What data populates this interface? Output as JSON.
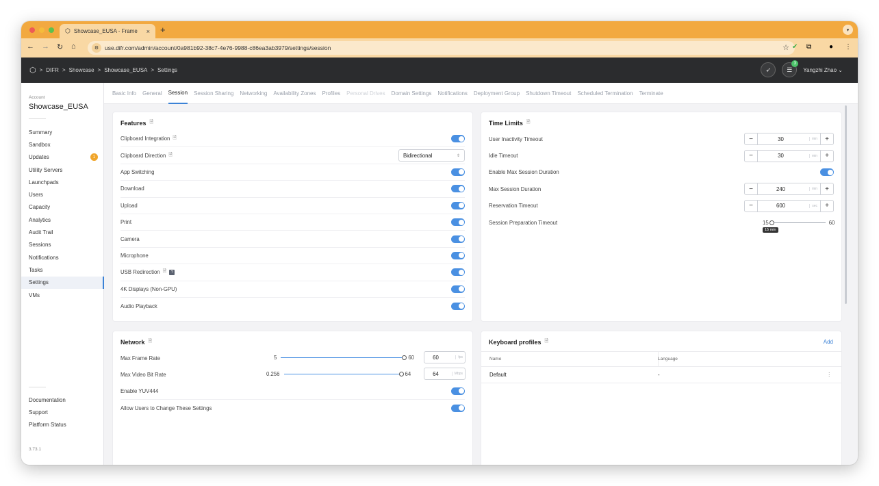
{
  "browser": {
    "tab_title": "Showcase_EUSA - Frame",
    "tab_close": "×",
    "new_tab": "+",
    "url": "use.difr.com/admin/account/0a981b92-38c7-4e76-9988-c86ea3ab3979/settings/session"
  },
  "header": {
    "breadcrumb": [
      "DIFR",
      "Showcase",
      "Showcase_EUSA",
      "Settings"
    ],
    "separator": ">",
    "notification_count": "3",
    "user_name": "Yangzhi Zhao"
  },
  "sidebar": {
    "account_label": "Account",
    "account_name": "Showcase_EUSA",
    "items": [
      {
        "label": "Summary"
      },
      {
        "label": "Sandbox"
      },
      {
        "label": "Updates",
        "badge": "1"
      },
      {
        "label": "Utility Servers"
      },
      {
        "label": "Launchpads"
      },
      {
        "label": "Users"
      },
      {
        "label": "Capacity"
      },
      {
        "label": "Analytics"
      },
      {
        "label": "Audit Trail"
      },
      {
        "label": "Sessions"
      },
      {
        "label": "Notifications"
      },
      {
        "label": "Tasks"
      },
      {
        "label": "Settings",
        "active": true
      },
      {
        "label": "VMs"
      }
    ],
    "footer_items": [
      {
        "label": "Documentation"
      },
      {
        "label": "Support"
      },
      {
        "label": "Platform Status"
      }
    ],
    "version": "3.73.1"
  },
  "subtabs": [
    {
      "label": "Basic Info"
    },
    {
      "label": "General"
    },
    {
      "label": "Session",
      "active": true
    },
    {
      "label": "Session Sharing"
    },
    {
      "label": "Networking"
    },
    {
      "label": "Availability Zones"
    },
    {
      "label": "Profiles"
    },
    {
      "label": "Personal Drives",
      "disabled": true
    },
    {
      "label": "Domain Settings"
    },
    {
      "label": "Notifications"
    },
    {
      "label": "Deployment Group"
    },
    {
      "label": "Shutdown Timeout"
    },
    {
      "label": "Scheduled Termination"
    },
    {
      "label": "Terminate"
    }
  ],
  "features": {
    "title": "Features",
    "rows": [
      {
        "label": "Clipboard Integration",
        "type": "toggle",
        "on": true
      },
      {
        "label": "Clipboard Direction",
        "type": "select",
        "value": "Bidirectional"
      },
      {
        "label": "App Switching",
        "type": "toggle",
        "on": true
      },
      {
        "label": "Download",
        "type": "toggle",
        "on": true
      },
      {
        "label": "Upload",
        "type": "toggle",
        "on": true
      },
      {
        "label": "Print",
        "type": "toggle",
        "on": true
      },
      {
        "label": "Camera",
        "type": "toggle",
        "on": true
      },
      {
        "label": "Microphone",
        "type": "toggle",
        "on": true
      },
      {
        "label": "USB Redirection",
        "type": "toggle",
        "on": true
      },
      {
        "label": "4K Displays (Non-GPU)",
        "type": "toggle",
        "on": true
      },
      {
        "label": "Audio Playback",
        "type": "toggle",
        "on": true
      }
    ]
  },
  "time_limits": {
    "title": "Time Limits",
    "user_inactivity": {
      "label": "User Inactivity Timeout",
      "value": "30",
      "unit": "min"
    },
    "idle": {
      "label": "Idle Timeout",
      "value": "30",
      "unit": "min"
    },
    "enable_max": {
      "label": "Enable Max Session Duration",
      "on": true
    },
    "max_duration": {
      "label": "Max Session Duration",
      "value": "240",
      "unit": "min"
    },
    "reservation": {
      "label": "Reservation Timeout",
      "value": "600",
      "unit": "sec"
    },
    "preparation": {
      "label": "Session Preparation Timeout",
      "min": "15",
      "max": "60",
      "value": 15,
      "tooltip": "15 min"
    }
  },
  "network": {
    "title": "Network",
    "frame_rate": {
      "label": "Max Frame Rate",
      "min": "5",
      "max": "60",
      "value": "60",
      "unit": "fps"
    },
    "bit_rate": {
      "label": "Max Video Bit Rate",
      "min": "0.256",
      "max": "64",
      "value": "64",
      "unit": "Mbps"
    },
    "yuv": {
      "label": "Enable YUV444",
      "on": true
    },
    "allow_users": {
      "label": "Allow Users to Change These Settings",
      "on": true
    }
  },
  "keyboard": {
    "title": "Keyboard profiles",
    "add_label": "Add",
    "col_name": "Name",
    "col_language": "Language",
    "rows": [
      {
        "name": "Default",
        "language": "-"
      }
    ]
  },
  "colors": {
    "accent": "#4a90e2",
    "header_bg": "#2b2c2e",
    "tab_bar": "#f2a940",
    "badge": "#f0a52a"
  }
}
